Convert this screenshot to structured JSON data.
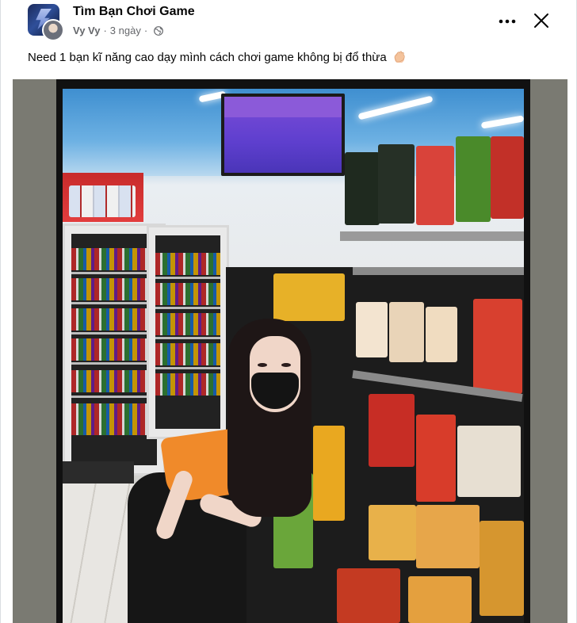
{
  "header": {
    "group_name": "Tìm Bạn Chơi Game",
    "author": "Vy Vy",
    "separator": "·",
    "time": "3 ngày",
    "separator2": "·",
    "privacy_icon": "globe-icon",
    "more_icon": "more-options-icon",
    "close_icon": "close-icon"
  },
  "post": {
    "text": "Need 1 bạn kĩ năng cao dạy mình cách chơi game không bị đổ thừa",
    "emoji_icon": "praying-hand-icon"
  },
  "colors": {
    "text_primary": "#050505",
    "text_secondary": "#65676b",
    "media_background": "#7a7a72"
  }
}
